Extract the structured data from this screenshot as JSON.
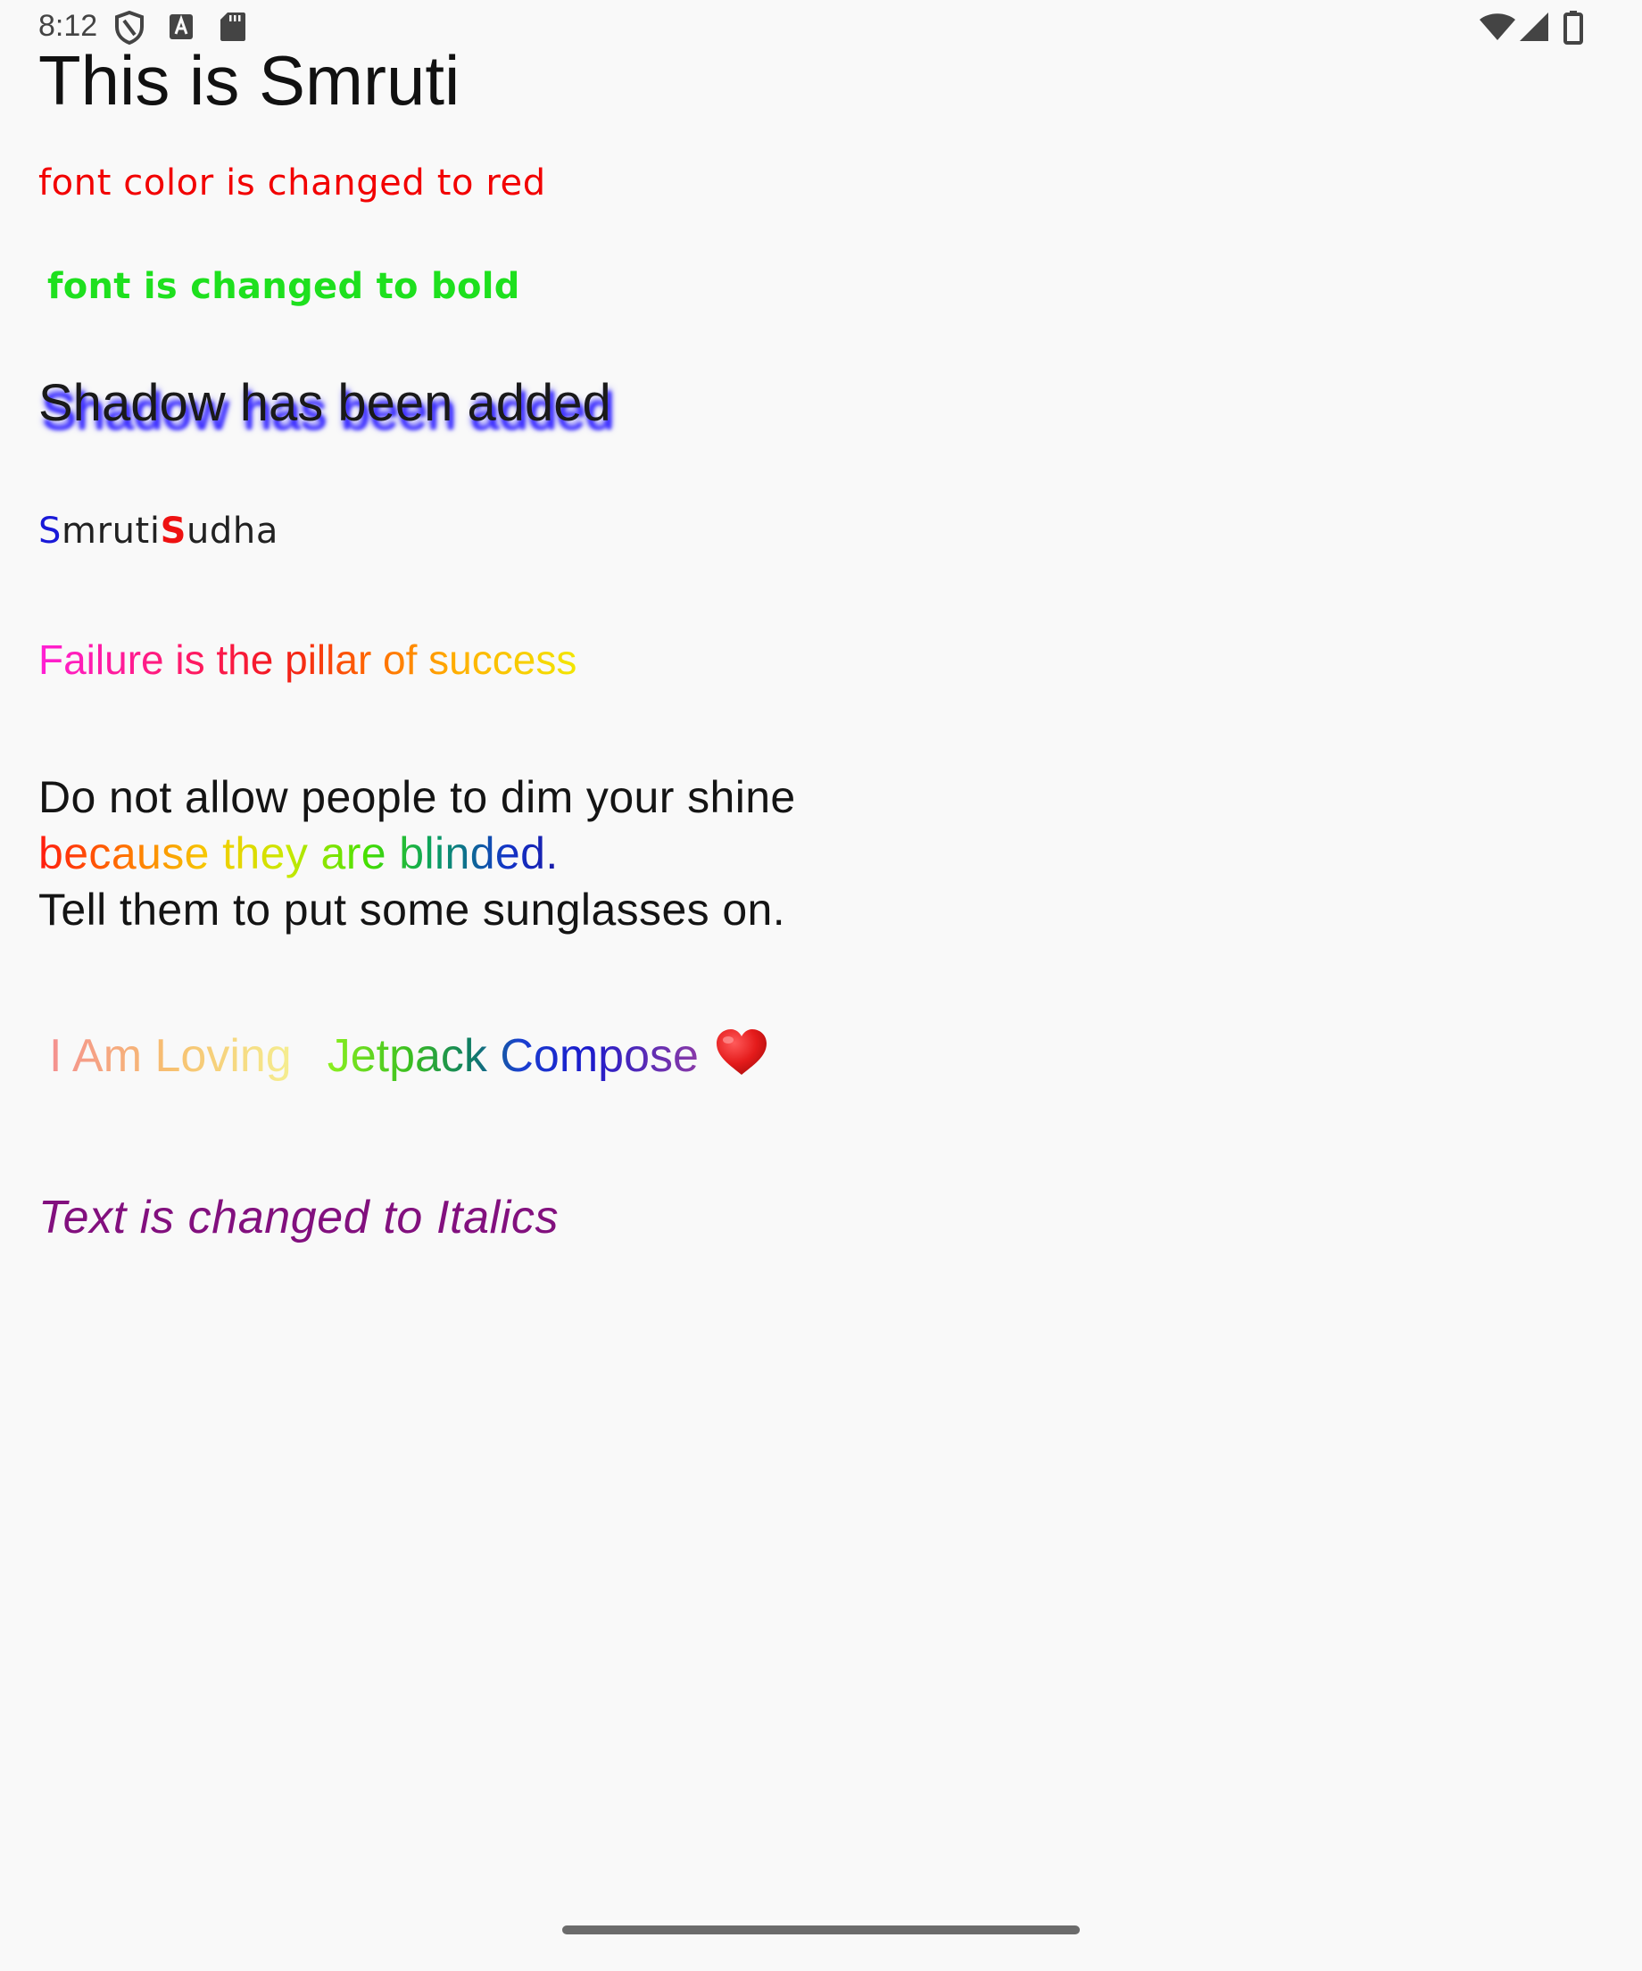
{
  "status_bar": {
    "time": "8:12",
    "left_icons": [
      "vpn-shield-icon",
      "text-a-icon",
      "sd-card-icon"
    ],
    "right_icons": [
      "wifi-icon",
      "cell-signal-icon",
      "battery-icon"
    ]
  },
  "screen": {
    "title": "This is Smruti",
    "red_text": "font color is changed to red",
    "bold_text": "font is changed to bold",
    "shadow_text": "Shadow has been added",
    "name": {
      "part1_initial": "S",
      "part1_rest": "mruti",
      "part2_initial": "S",
      "part2_rest": "udha"
    },
    "failure_text": "Failure is the pillar of success",
    "quote": {
      "line1": "Do not allow people to dim your shine",
      "line2": "because they are blinded.",
      "line3": "Tell them to put some sunglasses on."
    },
    "loving": {
      "part1": "I Am Loving",
      "part2": "Jetpack Compose",
      "heart_icon": "heart-emoji-icon"
    },
    "italic_text": "Text is changed to Italics"
  },
  "colors": {
    "background": "#f9f9f9",
    "red_text": "#f20000",
    "bold_text": "#1ee01e",
    "shadow": "#3a2cff",
    "italic_text": "#82107e"
  }
}
